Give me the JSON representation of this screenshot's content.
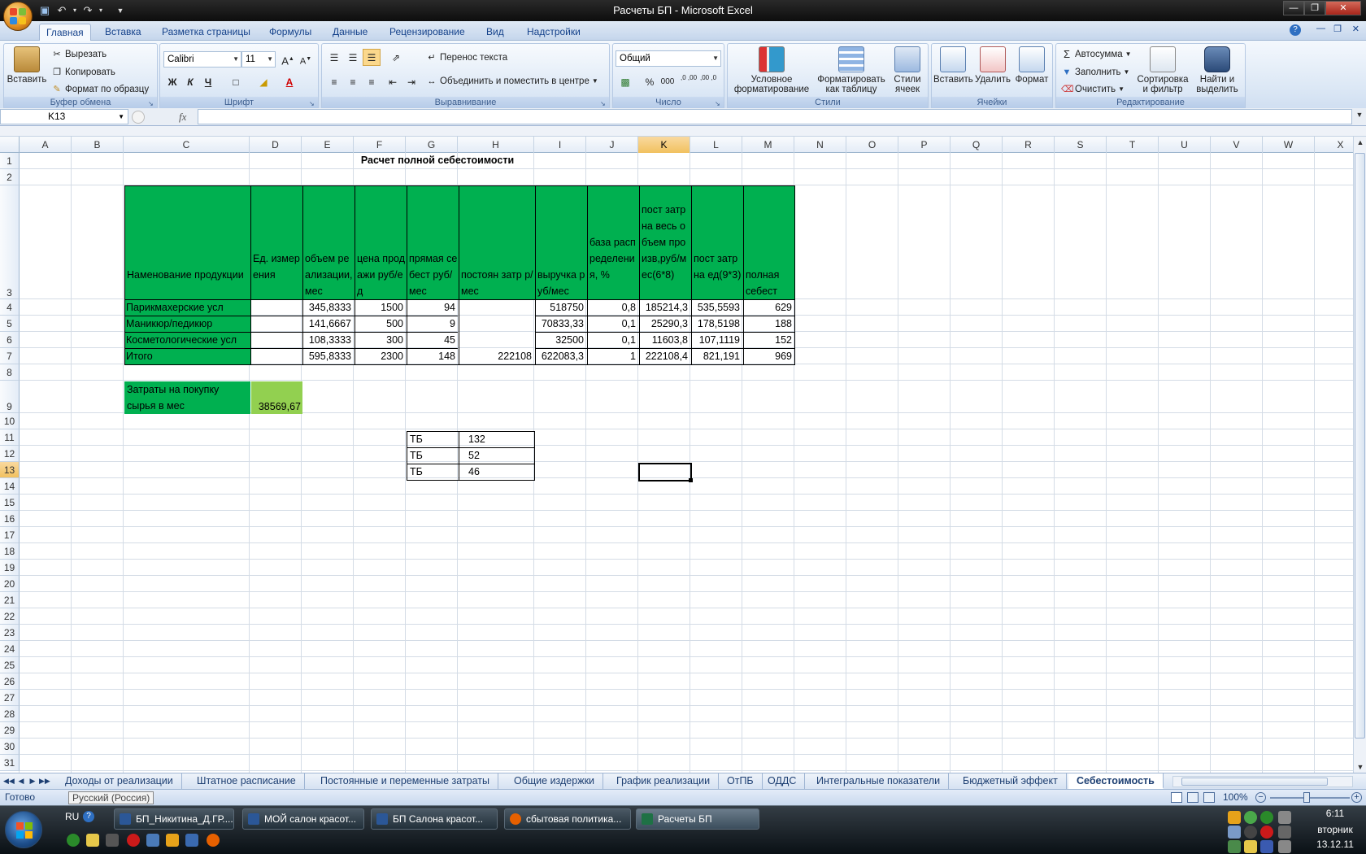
{
  "window": {
    "title": "Расчеты БП - Microsoft Excel"
  },
  "qat": {
    "icons": [
      "save-icon",
      "undo-icon",
      "redo-icon",
      "customize-icon"
    ]
  },
  "ribbon_tabs": [
    "Главная",
    "Вставка",
    "Разметка страницы",
    "Формулы",
    "Данные",
    "Рецензирование",
    "Вид",
    "Надстройки"
  ],
  "ribbon": {
    "clipboard": {
      "label": "Буфер обмена",
      "paste": "Вставить",
      "cut": "Вырезать",
      "copy": "Копировать",
      "format_painter": "Формат по образцу"
    },
    "font": {
      "label": "Шрифт",
      "font_name": "Calibri",
      "font_size": "11",
      "bold": "Ж",
      "italic": "К",
      "underline": "Ч",
      "grow": "A",
      "shrink": "A",
      "font_color": "A"
    },
    "alignment": {
      "label": "Выравнивание",
      "wrap": "Перенос текста",
      "merge": "Объединить и поместить в центре"
    },
    "number": {
      "label": "Число",
      "format": "Общий",
      "percent": "%",
      "thousands": "000",
      "inc_dec": ",0 ,00",
      "dec_dec": ",00 ,0"
    },
    "styles": {
      "label": "Стили",
      "cond_line1": "Условное",
      "cond_line2": "форматирование",
      "table_line1": "Форматировать",
      "table_line2": "как таблицу",
      "cell_line1": "Стили",
      "cell_line2": "ячеек"
    },
    "cells": {
      "label": "Ячейки",
      "insert": "Вставить",
      "delete": "Удалить",
      "format": "Формат"
    },
    "editing": {
      "label": "Редактирование",
      "autosum": "Автосумма",
      "fill": "Заполнить",
      "clear": "Очистить",
      "sort_line1": "Сортировка",
      "sort_line2": "и фильтр",
      "find_line1": "Найти и",
      "find_line2": "выделить"
    }
  },
  "formula_bar": {
    "name_box": "K13",
    "fx": "fx",
    "formula": ""
  },
  "columns": [
    "A",
    "B",
    "C",
    "D",
    "E",
    "F",
    "G",
    "H",
    "I",
    "J",
    "K",
    "L",
    "M",
    "N",
    "O",
    "P",
    "Q",
    "R",
    "S",
    "T",
    "U",
    "V",
    "W",
    "X"
  ],
  "rows": [
    "1",
    "2",
    "3",
    "4",
    "5",
    "6",
    "7",
    "8",
    "9",
    "10",
    "11",
    "12",
    "13",
    "14",
    "15",
    "16",
    "17",
    "18",
    "19",
    "20",
    "21",
    "22",
    "23",
    "24",
    "25",
    "26",
    "27",
    "28",
    "29",
    "30",
    "31"
  ],
  "sheet": {
    "title": "Расчет полной себестоимости",
    "header": {
      "c": "Наменование продукции",
      "d": "Ед. измерения",
      "e": "объем реализации,мес",
      "f": "цена продажи руб/ед",
      "g": "прямая себест руб/мес",
      "h": "постоян затр р/мес",
      "i": "выручка руб/мес",
      "j": "база распределения, %",
      "k": "пост затр на весь объем произв,руб/мес(6*8)",
      "l": "пост затр на ед(9*3)",
      "m": "полная себест"
    },
    "rows": [
      {
        "c": "Парикмахерские усл",
        "d": "",
        "e": "345,8333",
        "f": "1500",
        "g": "94",
        "h": "",
        "i": "518750",
        "j": "0,8",
        "k": "185214,3",
        "l": "535,5593",
        "m": "629"
      },
      {
        "c": "Маникюр/педикюр",
        "d": "",
        "e": "141,6667",
        "f": "500",
        "g": "9",
        "h": "",
        "i": "70833,33",
        "j": "0,1",
        "k": "25290,3",
        "l": "178,5198",
        "m": "188"
      },
      {
        "c": "Косметологические усл",
        "d": "",
        "e": "108,3333",
        "f": "300",
        "g": "45",
        "h": "",
        "i": "32500",
        "j": "0,1",
        "k": "11603,8",
        "l": "107,1119",
        "m": "152"
      },
      {
        "c": "Итого",
        "d": "",
        "e": "595,8333",
        "f": "2300",
        "g": "148",
        "h": "222108",
        "i": "622083,3",
        "j": "1",
        "k": "222108,4",
        "l": "821,191",
        "m": "969"
      }
    ],
    "raw_cost": {
      "label": "Затраты на покупку сырья в мес",
      "value": "38569,67"
    },
    "tb": [
      {
        "label": "ТБ",
        "value": "132"
      },
      {
        "label": "ТБ",
        "value": "52"
      },
      {
        "label": "ТБ",
        "value": "46"
      }
    ]
  },
  "sheet_tabs": [
    "Доходы от реализации",
    "Штатное расписание",
    "Постоянные и переменные затраты",
    "Общие издержки",
    "График реализации",
    "ОтПБ",
    "ОДДС",
    "Интегральные показатели",
    "Бюджетный эффект",
    "Себестоимость"
  ],
  "status": {
    "ready": "Готово",
    "language": "Русский (Россия)",
    "zoom": "100%"
  },
  "taskbar": {
    "lang": "RU",
    "tasks": [
      "БП_Никитина_Д.ГР....",
      "МОЙ салон красот...",
      "БП Салона красот...",
      "сбытовая политика...",
      "Расчеты БП"
    ],
    "time": "6:11",
    "day": "вторник",
    "date": "13.12.11"
  },
  "colors": {
    "green": "#00b050",
    "light_green": "#92d050",
    "ribbon_text": "#15428b"
  }
}
